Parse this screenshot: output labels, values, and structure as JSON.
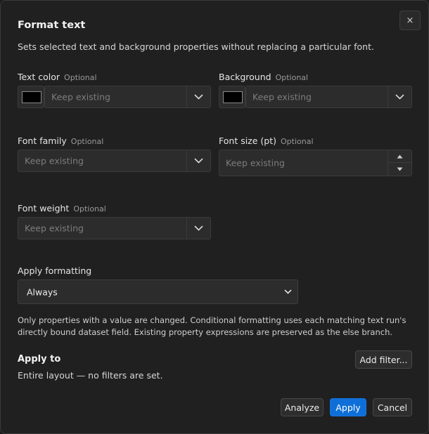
{
  "dialog": {
    "title": "Format text",
    "subtitle": "Sets selected text and background properties without replacing a particular font.",
    "close_label": "×"
  },
  "fields": {
    "text_color": {
      "label": "Text color",
      "optional": "Optional",
      "placeholder": "Keep existing",
      "swatch": "#000000"
    },
    "background": {
      "label": "Background",
      "optional": "Optional",
      "placeholder": "Keep existing",
      "swatch": "#000000"
    },
    "font_family": {
      "label": "Font family",
      "optional": "Optional",
      "placeholder": "Keep existing"
    },
    "font_size": {
      "label": "Font size (pt)",
      "optional": "Optional",
      "placeholder": "Keep existing"
    },
    "font_weight": {
      "label": "Font weight",
      "optional": "Optional",
      "placeholder": "Keep existing"
    }
  },
  "apply_formatting": {
    "label": "Apply formatting",
    "value": "Always"
  },
  "note": "Only properties with a value are changed. Conditional formatting uses each matching text run's directly bound dataset field. Existing property expressions are preserved as the else branch.",
  "apply_to": {
    "heading": "Apply to",
    "scope": "Entire layout — no filters are set.",
    "add_filter_label": "Add filter..."
  },
  "footer": {
    "analyze_label": "Analyze",
    "apply_label": "Apply",
    "cancel_label": "Cancel"
  },
  "colors": {
    "accent": "#0f6fd8",
    "background": "#202020"
  }
}
